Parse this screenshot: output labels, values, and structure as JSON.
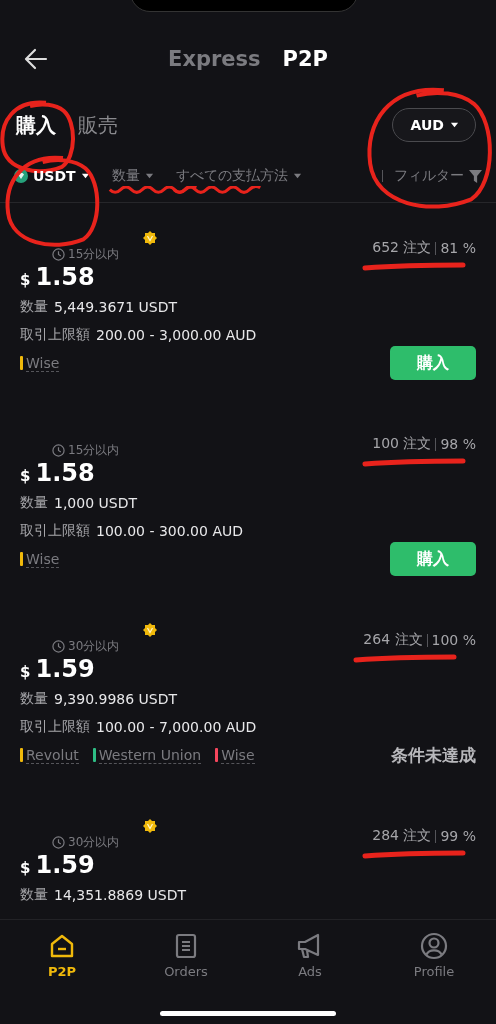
{
  "header": {
    "tabs": [
      {
        "label": "Express",
        "selected": false
      },
      {
        "label": "P2P",
        "selected": true
      }
    ]
  },
  "trade_tabs": [
    {
      "label": "購入",
      "selected": true,
      "circled": true
    },
    {
      "label": "販売",
      "selected": false,
      "circled": false
    }
  ],
  "currency": {
    "label": "AUD",
    "circled": true
  },
  "filters": [
    {
      "kind": "coin",
      "label": "USDT",
      "circled": true,
      "underlined": false
    },
    {
      "kind": "dropdown",
      "label": "数量",
      "circled": false,
      "underlined": true
    },
    {
      "kind": "dropdown",
      "label": "すべての支払方法",
      "circled": false,
      "underlined": true
    },
    {
      "kind": "filter",
      "label": "フィルター",
      "circled": false,
      "underlined": false
    }
  ],
  "listings": [
    {
      "verified": true,
      "time": "15分以内",
      "currency_symbol": "$",
      "price": "1.58",
      "quantity_label": "数量",
      "quantity": "5,449.3671 USDT",
      "limit_label": "取引上限額",
      "limit": "200.00 - 3,000.00 AUD",
      "payments": [
        {
          "name": "Wise",
          "color": "#f0b90b"
        }
      ],
      "orders": "652 注文",
      "completion": "81 %",
      "underlined": true,
      "action": {
        "kind": "button",
        "label": "購入"
      }
    },
    {
      "verified": false,
      "time": "15分以内",
      "currency_symbol": "$",
      "price": "1.58",
      "quantity_label": "数量",
      "quantity": "1,000 USDT",
      "limit_label": "取引上限額",
      "limit": "100.00 - 300.00 AUD",
      "payments": [
        {
          "name": "Wise",
          "color": "#f0b90b"
        }
      ],
      "orders": "100 注文",
      "completion": "98 %",
      "underlined": true,
      "action": {
        "kind": "button",
        "label": "購入"
      }
    },
    {
      "verified": true,
      "time": "30分以内",
      "currency_symbol": "$",
      "price": "1.59",
      "quantity_label": "数量",
      "quantity": "9,390.9986 USDT",
      "limit_label": "取引上限額",
      "limit": "100.00 - 7,000.00 AUD",
      "payments": [
        {
          "name": "Revolut",
          "color": "#f0b90b"
        },
        {
          "name": "Western Union",
          "color": "#2ebd85"
        },
        {
          "name": "Wise",
          "color": "#f6465d"
        }
      ],
      "orders": "264 注文",
      "completion": "100 %",
      "underlined": true,
      "action": {
        "kind": "status",
        "label": "条件未達成"
      }
    },
    {
      "verified": true,
      "time": "30分以内",
      "currency_symbol": "$",
      "price": "1.59",
      "quantity_label": "数量",
      "quantity": "14,351.8869 USDT",
      "orders": "284 注文",
      "completion": "99 %",
      "underlined": true
    }
  ],
  "nav": [
    {
      "kind": "home",
      "label": "P2P",
      "selected": true
    },
    {
      "kind": "orders",
      "label": "Orders",
      "selected": false
    },
    {
      "kind": "ads",
      "label": "Ads",
      "selected": false
    },
    {
      "kind": "profile",
      "label": "Profile",
      "selected": false
    }
  ]
}
